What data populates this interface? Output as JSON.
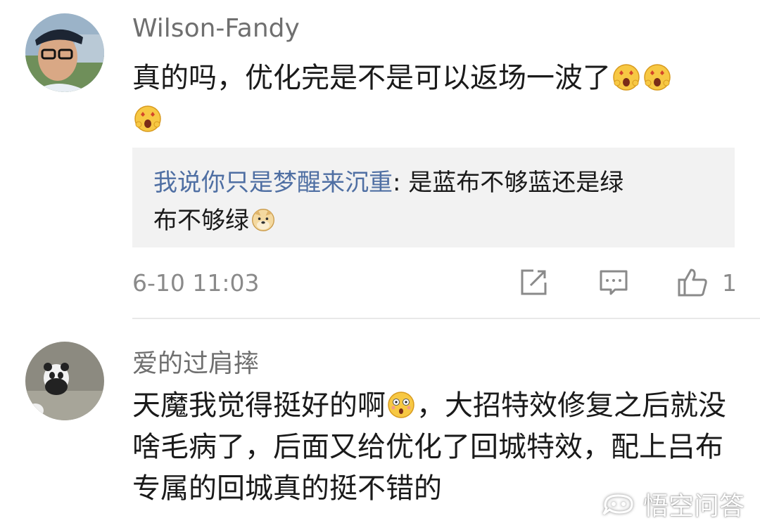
{
  "comments": [
    {
      "username": "Wilson-Fandy",
      "text_line1": "真的吗，优化完是不是可以返场一波了",
      "emoji": "starstruck-emoji",
      "reply": {
        "author": "我说你只是梦醒来沉重",
        "separator": ": ",
        "text_part1": "是蓝布不够蓝还是绿",
        "text_part2": "布不够绿",
        "emoji": "doge-emoji"
      },
      "time": "6-10 11:03",
      "likes": "1"
    },
    {
      "username": "爱的过肩摔",
      "text_part1": "天魔我觉得挺好的啊",
      "emoji": "shocked-emoji",
      "text_part2": "，大招特效修复之后就没啥毛病了，后面又给优化了回城特效，配上吕布专属的回城真的挺不错的"
    }
  ],
  "watermark": {
    "label": "悟空问答"
  },
  "colors": {
    "reply_author": "#4f6fa3",
    "username": "#6f6f6f",
    "quote_bg": "#f2f2f2"
  }
}
